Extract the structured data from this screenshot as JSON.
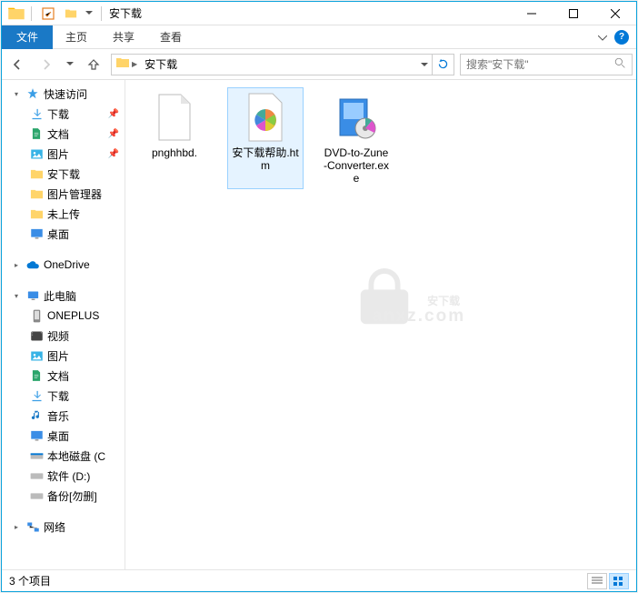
{
  "title": "安下载",
  "ribbon": {
    "file": "文件",
    "tabs": [
      "主页",
      "共享",
      "查看"
    ]
  },
  "breadcrumb": {
    "seg": "安下载"
  },
  "search": {
    "placeholder": "搜索\"安下载\""
  },
  "sidebar": {
    "quick": {
      "label": "快速访问",
      "items": [
        {
          "label": "下载",
          "pinned": true,
          "icon": "download"
        },
        {
          "label": "文档",
          "pinned": true,
          "icon": "document"
        },
        {
          "label": "图片",
          "pinned": true,
          "icon": "picture"
        },
        {
          "label": "安下载",
          "pinned": false,
          "icon": "folder"
        },
        {
          "label": "图片管理器",
          "pinned": false,
          "icon": "folder"
        },
        {
          "label": "未上传",
          "pinned": false,
          "icon": "folder"
        },
        {
          "label": "桌面",
          "pinned": false,
          "icon": "desktop"
        }
      ]
    },
    "onedrive": {
      "label": "OneDrive"
    },
    "thispc": {
      "label": "此电脑",
      "items": [
        {
          "label": "ONEPLUS",
          "icon": "phone"
        },
        {
          "label": "视频",
          "icon": "video"
        },
        {
          "label": "图片",
          "icon": "picture"
        },
        {
          "label": "文档",
          "icon": "document"
        },
        {
          "label": "下载",
          "icon": "download"
        },
        {
          "label": "音乐",
          "icon": "music"
        },
        {
          "label": "桌面",
          "icon": "desktop"
        },
        {
          "label": "本地磁盘 (C",
          "icon": "drive-c"
        },
        {
          "label": "软件 (D:)",
          "icon": "drive"
        },
        {
          "label": "备份[勿删]",
          "icon": "drive"
        }
      ]
    },
    "network": {
      "label": "网络"
    }
  },
  "files": [
    {
      "name": "pnghhbd.",
      "type": "blank"
    },
    {
      "name": "安下载帮助.htm",
      "type": "htm",
      "selected": true
    },
    {
      "name": "DVD-to-Zune-Converter.exe",
      "type": "exe"
    }
  ],
  "status": {
    "count": "3 个项目"
  },
  "watermark": {
    "main": "安下载",
    "sub": "anxz.com"
  }
}
